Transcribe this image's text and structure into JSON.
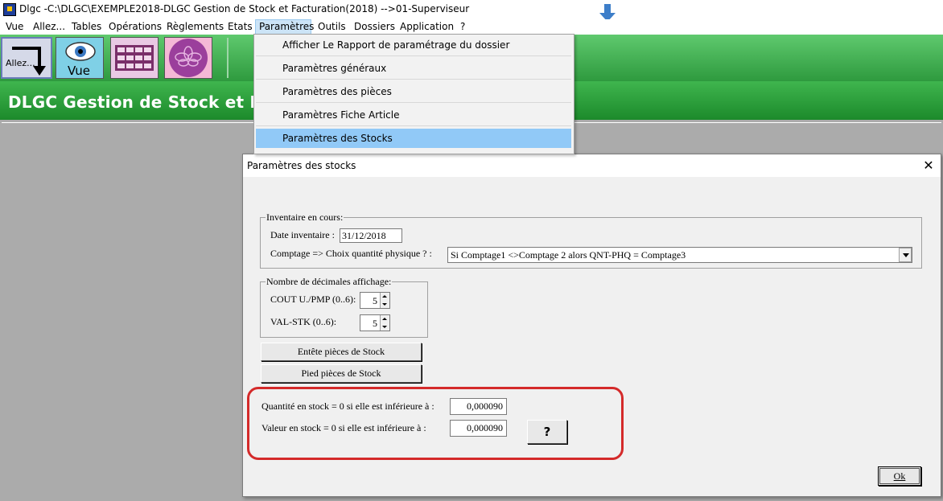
{
  "window": {
    "title": "Dlgc -C:\\DLGC\\EXEMPLE2018-DLGC Gestion de Stock et Facturation(2018) -->01-Superviseur"
  },
  "menubar": [
    "Vue",
    "Allez...",
    "Tables",
    "Opérations",
    "Règlements",
    "Etats",
    "Paramètres",
    "Outils",
    "Dossiers",
    "Application",
    "?"
  ],
  "toolbar": {
    "allez_label": "Allez...",
    "vue_label": "Vue"
  },
  "banner": {
    "text": "DLGC Gestion de Stock et Factu"
  },
  "dropdown": {
    "items": [
      "Afficher Le Rapport de paramétrage du dossier",
      "Paramètres généraux",
      "Paramètres des pièces",
      "Paramètres Fiche Article",
      "Paramètres des Stocks"
    ],
    "highlighted_index": 4
  },
  "dialog": {
    "title": "Paramètres des stocks",
    "close_glyph": "✕",
    "inventory": {
      "legend": "Inventaire en cours:",
      "date_label": "Date inventaire :",
      "date_value": "31/12/2018",
      "comptage_label": "Comptage => Choix quantité physique ? :",
      "comptage_value": "Si Comptage1 <>Comptage 2 alors QNT-PHQ = Comptage3"
    },
    "decimals": {
      "legend": "Nombre de décimales affichage:",
      "cout_label": "COUT U./PMP (0..6):",
      "cout_value": "5",
      "valstk_label": "VAL-STK (0..6):",
      "valstk_value": "5"
    },
    "buttons": {
      "entete": "Entête pièces de Stock",
      "pied": "Pied pièces de Stock",
      "help": "?",
      "ok": "Ok"
    },
    "thresholds": {
      "qty_label": "Quantité en stock = 0 si elle est inférieure à :",
      "qty_value": "0,000090",
      "val_label": "Valeur en stock  = 0 si elle est inférieure à :",
      "val_value": "0,000090"
    }
  },
  "colors": {
    "banner": "#2ea13d",
    "highlight": "#91c9f7",
    "annotation_ring": "#d42a2a"
  }
}
